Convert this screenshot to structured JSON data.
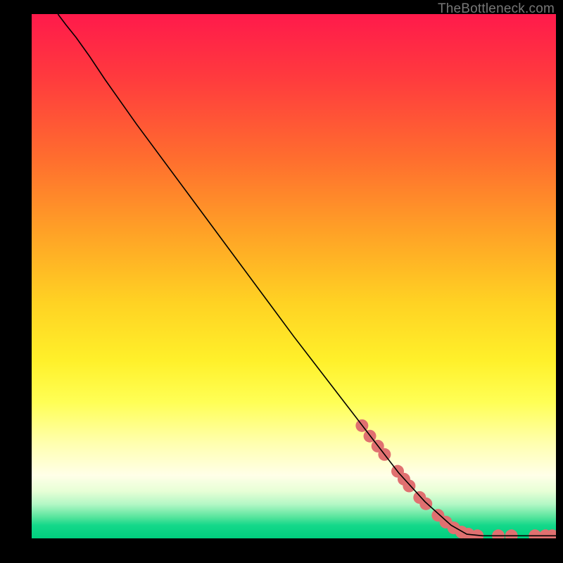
{
  "watermark": "TheBottleneck.com",
  "chart_data": {
    "type": "line",
    "title": "",
    "xlabel": "",
    "ylabel": "",
    "xlim": [
      0,
      100
    ],
    "ylim": [
      0,
      100
    ],
    "curve": [
      {
        "x": 5.0,
        "y": 100.0
      },
      {
        "x": 6.5,
        "y": 98.0
      },
      {
        "x": 8.5,
        "y": 95.5
      },
      {
        "x": 11.0,
        "y": 92.0
      },
      {
        "x": 14.0,
        "y": 87.5
      },
      {
        "x": 20.0,
        "y": 79.0
      },
      {
        "x": 30.0,
        "y": 65.5
      },
      {
        "x": 40.0,
        "y": 52.0
      },
      {
        "x": 50.0,
        "y": 38.5
      },
      {
        "x": 60.0,
        "y": 25.5
      },
      {
        "x": 65.0,
        "y": 19.0
      },
      {
        "x": 70.0,
        "y": 12.5
      },
      {
        "x": 75.0,
        "y": 7.0
      },
      {
        "x": 80.0,
        "y": 2.5
      },
      {
        "x": 83.0,
        "y": 0.8
      },
      {
        "x": 86.0,
        "y": 0.5
      },
      {
        "x": 90.0,
        "y": 0.5
      },
      {
        "x": 95.0,
        "y": 0.5
      },
      {
        "x": 100.0,
        "y": 0.5
      }
    ],
    "highlights": [
      {
        "x": 63.0,
        "y": 21.5
      },
      {
        "x": 64.5,
        "y": 19.5
      },
      {
        "x": 66.0,
        "y": 17.6
      },
      {
        "x": 67.3,
        "y": 16.0
      },
      {
        "x": 69.8,
        "y": 12.8
      },
      {
        "x": 71.0,
        "y": 11.3
      },
      {
        "x": 72.0,
        "y": 10.0
      },
      {
        "x": 74.0,
        "y": 7.8
      },
      {
        "x": 75.2,
        "y": 6.6
      },
      {
        "x": 77.5,
        "y": 4.4
      },
      {
        "x": 79.0,
        "y": 3.1
      },
      {
        "x": 80.5,
        "y": 2.0
      },
      {
        "x": 82.0,
        "y": 1.2
      },
      {
        "x": 83.3,
        "y": 0.8
      },
      {
        "x": 85.0,
        "y": 0.5
      },
      {
        "x": 89.0,
        "y": 0.5
      },
      {
        "x": 91.5,
        "y": 0.5
      },
      {
        "x": 96.0,
        "y": 0.5
      },
      {
        "x": 98.0,
        "y": 0.5
      },
      {
        "x": 99.3,
        "y": 0.5
      }
    ],
    "highlight_color": "#e07070",
    "highlight_radius_px": 9
  }
}
